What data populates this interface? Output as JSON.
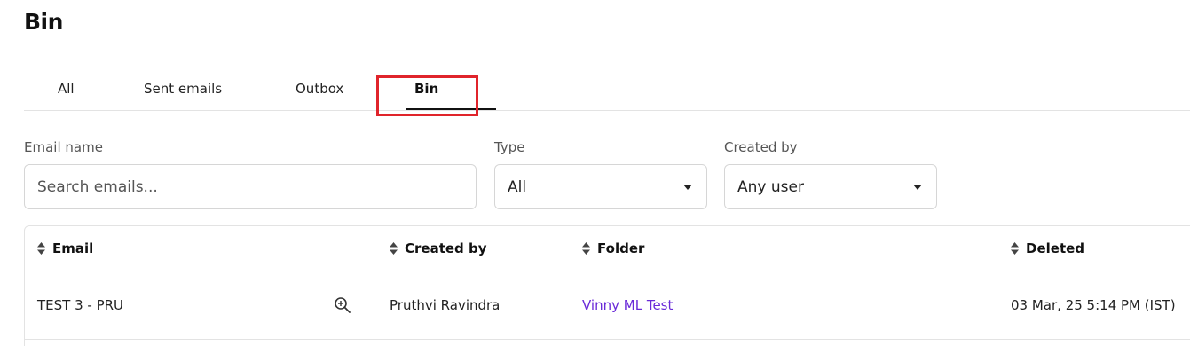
{
  "page": {
    "title": "Bin"
  },
  "tabs": [
    {
      "label": "All",
      "active": false
    },
    {
      "label": "Sent emails",
      "active": false
    },
    {
      "label": "Outbox",
      "active": false
    },
    {
      "label": "Bin",
      "active": true
    }
  ],
  "filters": {
    "email_name": {
      "label": "Email name",
      "placeholder": "Search emails...",
      "value": ""
    },
    "type": {
      "label": "Type",
      "value": "All"
    },
    "created_by": {
      "label": "Created by",
      "value": "Any user"
    }
  },
  "table": {
    "columns": [
      {
        "label": "Email",
        "icon": "sort-icon"
      },
      {
        "label": "Created by",
        "icon": "sort-icon"
      },
      {
        "label": "Folder",
        "icon": "sort-icon"
      },
      {
        "label": "Deleted",
        "icon": "sort-icon"
      }
    ],
    "rows": [
      {
        "email": "TEST 3 - PRU",
        "created_by": "Pruthvi Ravindra",
        "folder": "Vinny ML Test",
        "deleted": "03 Mar, 25 5:14 PM (IST)"
      }
    ]
  },
  "colors": {
    "highlight": "#e0242b",
    "link": "#6a2ad8",
    "border": "#e3e3e3"
  }
}
